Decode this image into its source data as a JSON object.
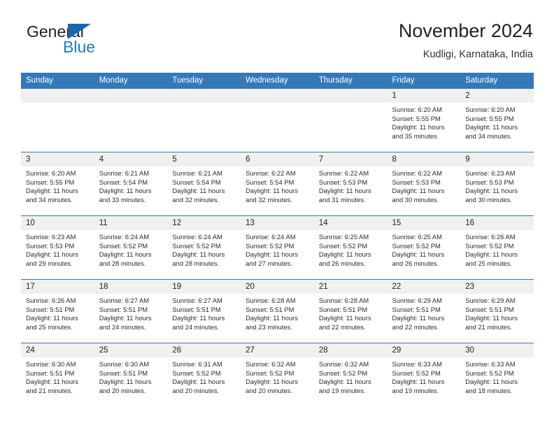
{
  "brand": {
    "word_top": "General",
    "word_bottom": "Blue",
    "triangle_color": "#1567ad",
    "blue_color": "#1b7fc4"
  },
  "header": {
    "title": "November 2024",
    "subtitle": "Kudligi, Karnataka, India"
  },
  "theme": {
    "header_blue": "#3479b8",
    "daynum_band": "#f0f0f0",
    "cell_bg": "#ffffff"
  },
  "weekday_headers": [
    "Sunday",
    "Monday",
    "Tuesday",
    "Wednesday",
    "Thursday",
    "Friday",
    "Saturday"
  ],
  "labels": {
    "sunrise_prefix": "Sunrise:",
    "sunset_prefix": "Sunset:",
    "daylight_prefix": "Daylight:"
  },
  "weeks": [
    [
      {
        "day": "",
        "empty": true
      },
      {
        "day": "",
        "empty": true
      },
      {
        "day": "",
        "empty": true
      },
      {
        "day": "",
        "empty": true
      },
      {
        "day": "",
        "empty": true
      },
      {
        "day": "1",
        "sunrise": "Sunrise: 6:20 AM",
        "sunset": "Sunset: 5:55 PM",
        "daylight": "Daylight: 11 hours and 35 minutes."
      },
      {
        "day": "2",
        "sunrise": "Sunrise: 6:20 AM",
        "sunset": "Sunset: 5:55 PM",
        "daylight": "Daylight: 11 hours and 34 minutes."
      }
    ],
    [
      {
        "day": "3",
        "sunrise": "Sunrise: 6:20 AM",
        "sunset": "Sunset: 5:55 PM",
        "daylight": "Daylight: 11 hours and 34 minutes."
      },
      {
        "day": "4",
        "sunrise": "Sunrise: 6:21 AM",
        "sunset": "Sunset: 5:54 PM",
        "daylight": "Daylight: 11 hours and 33 minutes."
      },
      {
        "day": "5",
        "sunrise": "Sunrise: 6:21 AM",
        "sunset": "Sunset: 5:54 PM",
        "daylight": "Daylight: 11 hours and 32 minutes."
      },
      {
        "day": "6",
        "sunrise": "Sunrise: 6:22 AM",
        "sunset": "Sunset: 5:54 PM",
        "daylight": "Daylight: 11 hours and 32 minutes."
      },
      {
        "day": "7",
        "sunrise": "Sunrise: 6:22 AM",
        "sunset": "Sunset: 5:53 PM",
        "daylight": "Daylight: 11 hours and 31 minutes."
      },
      {
        "day": "8",
        "sunrise": "Sunrise: 6:22 AM",
        "sunset": "Sunset: 5:53 PM",
        "daylight": "Daylight: 11 hours and 30 minutes."
      },
      {
        "day": "9",
        "sunrise": "Sunrise: 6:23 AM",
        "sunset": "Sunset: 5:53 PM",
        "daylight": "Daylight: 11 hours and 30 minutes."
      }
    ],
    [
      {
        "day": "10",
        "sunrise": "Sunrise: 6:23 AM",
        "sunset": "Sunset: 5:53 PM",
        "daylight": "Daylight: 11 hours and 29 minutes."
      },
      {
        "day": "11",
        "sunrise": "Sunrise: 6:24 AM",
        "sunset": "Sunset: 5:52 PM",
        "daylight": "Daylight: 11 hours and 28 minutes."
      },
      {
        "day": "12",
        "sunrise": "Sunrise: 6:24 AM",
        "sunset": "Sunset: 5:52 PM",
        "daylight": "Daylight: 11 hours and 28 minutes."
      },
      {
        "day": "13",
        "sunrise": "Sunrise: 6:24 AM",
        "sunset": "Sunset: 5:52 PM",
        "daylight": "Daylight: 11 hours and 27 minutes."
      },
      {
        "day": "14",
        "sunrise": "Sunrise: 6:25 AM",
        "sunset": "Sunset: 5:52 PM",
        "daylight": "Daylight: 11 hours and 26 minutes."
      },
      {
        "day": "15",
        "sunrise": "Sunrise: 6:25 AM",
        "sunset": "Sunset: 5:52 PM",
        "daylight": "Daylight: 11 hours and 26 minutes."
      },
      {
        "day": "16",
        "sunrise": "Sunrise: 6:26 AM",
        "sunset": "Sunset: 5:52 PM",
        "daylight": "Daylight: 11 hours and 25 minutes."
      }
    ],
    [
      {
        "day": "17",
        "sunrise": "Sunrise: 6:26 AM",
        "sunset": "Sunset: 5:51 PM",
        "daylight": "Daylight: 11 hours and 25 minutes."
      },
      {
        "day": "18",
        "sunrise": "Sunrise: 6:27 AM",
        "sunset": "Sunset: 5:51 PM",
        "daylight": "Daylight: 11 hours and 24 minutes."
      },
      {
        "day": "19",
        "sunrise": "Sunrise: 6:27 AM",
        "sunset": "Sunset: 5:51 PM",
        "daylight": "Daylight: 11 hours and 24 minutes."
      },
      {
        "day": "20",
        "sunrise": "Sunrise: 6:28 AM",
        "sunset": "Sunset: 5:51 PM",
        "daylight": "Daylight: 11 hours and 23 minutes."
      },
      {
        "day": "21",
        "sunrise": "Sunrise: 6:28 AM",
        "sunset": "Sunset: 5:51 PM",
        "daylight": "Daylight: 11 hours and 22 minutes."
      },
      {
        "day": "22",
        "sunrise": "Sunrise: 6:29 AM",
        "sunset": "Sunset: 5:51 PM",
        "daylight": "Daylight: 11 hours and 22 minutes."
      },
      {
        "day": "23",
        "sunrise": "Sunrise: 6:29 AM",
        "sunset": "Sunset: 5:51 PM",
        "daylight": "Daylight: 11 hours and 21 minutes."
      }
    ],
    [
      {
        "day": "24",
        "sunrise": "Sunrise: 6:30 AM",
        "sunset": "Sunset: 5:51 PM",
        "daylight": "Daylight: 11 hours and 21 minutes."
      },
      {
        "day": "25",
        "sunrise": "Sunrise: 6:30 AM",
        "sunset": "Sunset: 5:51 PM",
        "daylight": "Daylight: 11 hours and 20 minutes."
      },
      {
        "day": "26",
        "sunrise": "Sunrise: 6:31 AM",
        "sunset": "Sunset: 5:52 PM",
        "daylight": "Daylight: 11 hours and 20 minutes."
      },
      {
        "day": "27",
        "sunrise": "Sunrise: 6:32 AM",
        "sunset": "Sunset: 5:52 PM",
        "daylight": "Daylight: 11 hours and 20 minutes."
      },
      {
        "day": "28",
        "sunrise": "Sunrise: 6:32 AM",
        "sunset": "Sunset: 5:52 PM",
        "daylight": "Daylight: 11 hours and 19 minutes."
      },
      {
        "day": "29",
        "sunrise": "Sunrise: 6:33 AM",
        "sunset": "Sunset: 5:52 PM",
        "daylight": "Daylight: 11 hours and 19 minutes."
      },
      {
        "day": "30",
        "sunrise": "Sunrise: 6:33 AM",
        "sunset": "Sunset: 5:52 PM",
        "daylight": "Daylight: 11 hours and 18 minutes."
      }
    ]
  ]
}
